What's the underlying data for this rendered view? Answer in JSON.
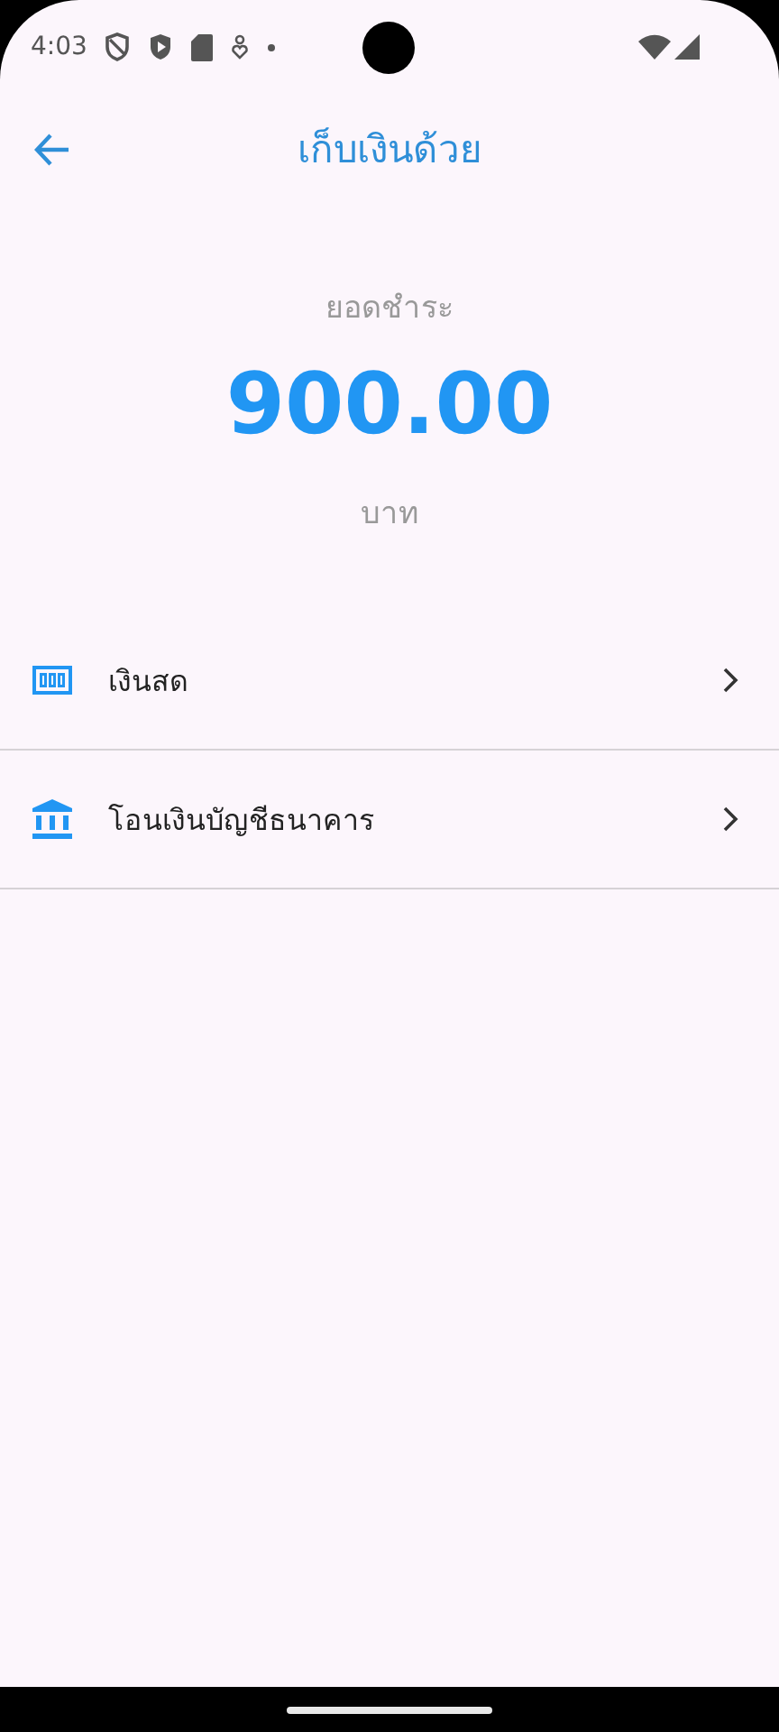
{
  "status_bar": {
    "time": "4:03"
  },
  "header": {
    "title": "เก็บเงินด้วย"
  },
  "amount": {
    "label": "ยอดชำระ",
    "value": "900.00",
    "unit": "บาท"
  },
  "options": [
    {
      "kind": "cash",
      "label": "เงินสด"
    },
    {
      "kind": "bank",
      "label": "โอนเงินบัญชีธนาคาร"
    }
  ]
}
